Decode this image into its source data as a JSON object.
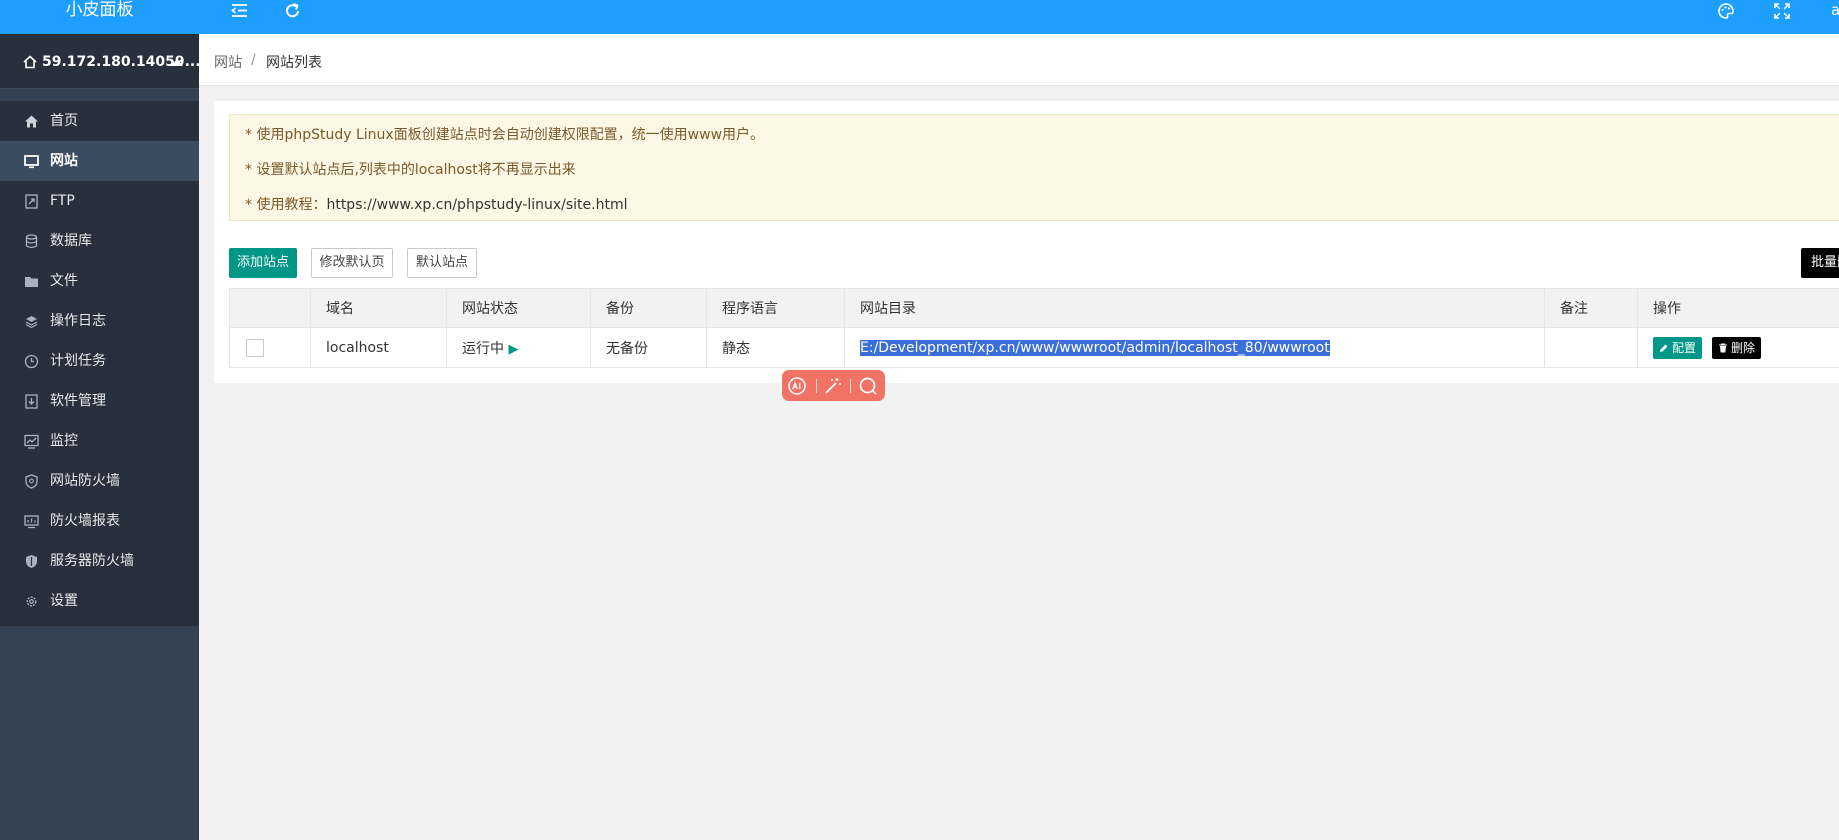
{
  "brand": {
    "title": "小皮面板"
  },
  "server": {
    "ip": "59.172.180.14059..."
  },
  "menu": [
    {
      "label": "首页",
      "icon": "home-icon"
    },
    {
      "label": "网站",
      "icon": "monitor-icon",
      "active": true
    },
    {
      "label": "FTP",
      "icon": "ftp-icon"
    },
    {
      "label": "数据库",
      "icon": "database-icon"
    },
    {
      "label": "文件",
      "icon": "folder-icon"
    },
    {
      "label": "操作日志",
      "icon": "layers-icon"
    },
    {
      "label": "计划任务",
      "icon": "clock-icon"
    },
    {
      "label": "软件管理",
      "icon": "download-icon"
    },
    {
      "label": "监控",
      "icon": "chart-icon"
    },
    {
      "label": "网站防火墙",
      "icon": "shield-icon"
    },
    {
      "label": "防火墙报表",
      "icon": "report-icon"
    },
    {
      "label": "服务器防火墙",
      "icon": "shield-check-icon"
    },
    {
      "label": "设置",
      "icon": "gear-icon"
    }
  ],
  "topbar": {
    "user_initial": "a"
  },
  "breadcrumb": {
    "root": "网站",
    "separator": "/",
    "current": "网站列表"
  },
  "tips": [
    "* 使用phpStudy Linux面板创建站点时会自动创建权限配置，统一使用www用户。",
    "* 设置默认站点后,列表中的localhost将不再显示出来",
    "* 使用教程："
  ],
  "tips_link": "https://www.xp.cn/phpstudy-linux/site.html",
  "actions": {
    "add_site": "添加站点",
    "edit_default_page": "修改默认页",
    "default_site": "默认站点",
    "batch": "批量删"
  },
  "table": {
    "columns": [
      "",
      "域名",
      "网站状态",
      "备份",
      "程序语言",
      "网站目录",
      "备注",
      "操作"
    ],
    "rows": [
      {
        "domain": "localhost",
        "status": "运行中",
        "status_icon": "▶",
        "backup": "无备份",
        "language": "静态",
        "path": "E:/Development/xp.cn/www/wwwroot/admin/localhost_80/wwwroot",
        "note": "",
        "config_label": "配置",
        "delete_label": "删除"
      }
    ]
  },
  "colors": {
    "topbar": "#1e9fff",
    "sidebar": "#28303e",
    "accent_green": "#009688",
    "tips_bg": "#fdf7e5",
    "ai_toolbar": "#f07366"
  }
}
